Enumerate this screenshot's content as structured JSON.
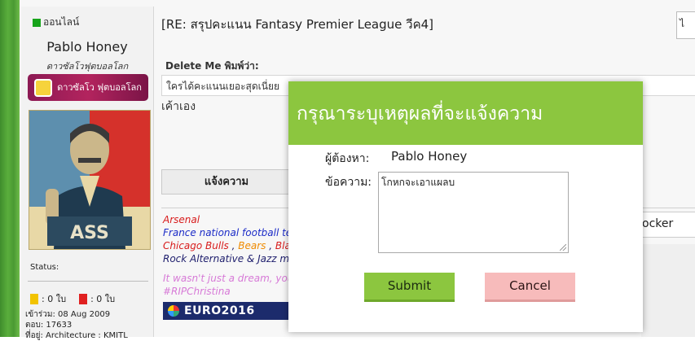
{
  "colors": {
    "modal_header": "#8cc63f",
    "submit_bg": "#8cc63f",
    "cancel_bg": "#f7bbbb",
    "online_dot": "#17a41b"
  },
  "sidebar": {
    "online_label": "ออนไลน์",
    "username": "Pablo Honey",
    "user_title": "ดาวซัลโวฟุตบอลโลก",
    "badge_text": "ดาวซัลโว ฟุตบอลโลก",
    "avatar_caption": "ASS",
    "status_label": "Status:",
    "yellow_count": ": 0 ใบ",
    "red_count": ": 0 ใบ",
    "joined": "เข้าร่วม: 08 Aug 2009",
    "posts": "ตอบ: 17633",
    "location": "ที่อยู่: Architecture : KMITL"
  },
  "post": {
    "title": "[RE: สรุปคะแนน Fantasy Premier League วีค4]",
    "top_right_glyph": "ไ",
    "quote_author": "Delete Me พิมพ์ว่า:",
    "quote_text": "ใครได้คะแนนเยอะสุดเนี่ยย",
    "reply_text": "เค้าเอง",
    "report_label": "แจ้งความ",
    "right_field_text": "ocker"
  },
  "signature": {
    "line1": "Arsenal",
    "line2": "France national football tea",
    "line3a": "Chicago Bulls",
    "line3sep1": " , ",
    "line3b": "Bears",
    "line3sep2": " , ",
    "line3c": "Blac",
    "line4": "Rock Alternative & Jazz mu",
    "line5": "It wasn't just a dream, you",
    "line6": "#RIPChristina",
    "euro_text": "EURO2016"
  },
  "modal": {
    "title": "กรุณาระบุเหตุผลที่จะแจ้งความ",
    "to_label": "ผู้ต้องหา:",
    "to_value": "Pablo Honey",
    "message_label": "ข้อความ:",
    "message_value": "โกหกจะเอาแผลบ",
    "submit_label": "Submit",
    "cancel_label": "Cancel"
  }
}
